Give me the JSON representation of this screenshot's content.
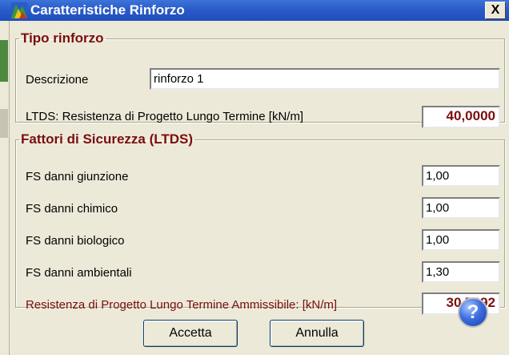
{
  "window": {
    "title": "Caratteristiche Rinforzo",
    "close_glyph": "X"
  },
  "tipo_rinforzo": {
    "legend": "Tipo rinforzo",
    "descrizione_label": "Descrizione",
    "descrizione_value": "rinforzo 1",
    "ltds_label": "LTDS: Resistenza di Progetto Lungo Termine  [kN/m]",
    "ltds_value": "40,0000"
  },
  "fattori": {
    "legend": "Fattori di Sicurezza (LTDS)",
    "rows": [
      {
        "label": "FS danni giunzione",
        "value": "1,00"
      },
      {
        "label": "FS danni chimico",
        "value": "1,00"
      },
      {
        "label": "FS danni biologico",
        "value": "1,00"
      },
      {
        "label": "FS danni ambientali",
        "value": "1,30"
      }
    ],
    "ammissibile_label": "Resistenza di Progetto Lungo Termine Ammissibile:  [kN/m]",
    "ammissibile_value": "30,7692"
  },
  "buttons": {
    "accetta": "Accetta",
    "annulla": "Annulla",
    "help_glyph": "?"
  },
  "colors": {
    "accent_red": "#7a0e0e",
    "titlebar_blue": "#2a5bc9"
  }
}
